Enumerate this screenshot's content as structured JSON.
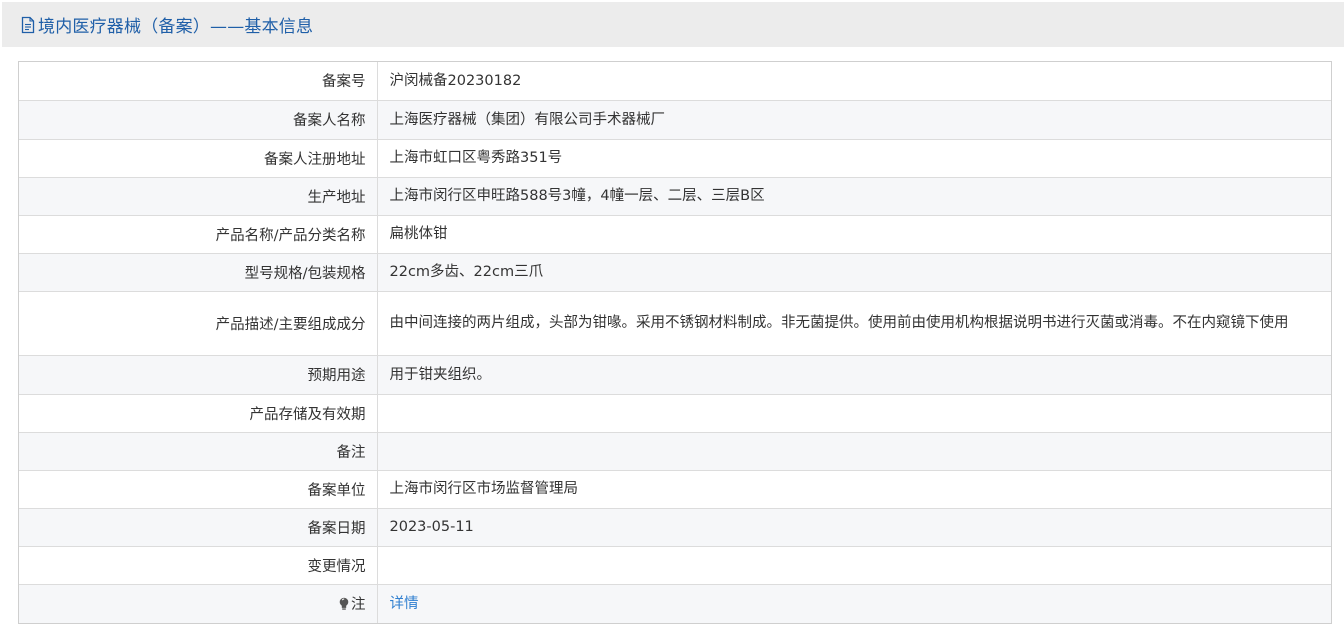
{
  "header": {
    "title": "境内医疗器械（备案）——基本信息"
  },
  "rows": [
    {
      "label": "备案号",
      "value": "沪闵械备20230182"
    },
    {
      "label": "备案人名称",
      "value": "上海医疗器械（集团）有限公司手术器械厂"
    },
    {
      "label": "备案人注册地址",
      "value": "上海市虹口区粤秀路351号"
    },
    {
      "label": "生产地址",
      "value": "上海市闵行区申旺路588号3幢，4幢一层、二层、三层B区"
    },
    {
      "label": "产品名称/产品分类名称",
      "value": "扁桃体钳"
    },
    {
      "label": "型号规格/包装规格",
      "value": "22cm多齿、22cm三爪"
    },
    {
      "label": "产品描述/主要组成成分",
      "value": "由中间连接的两片组成，头部为钳喙。采用不锈钢材料制成。非无菌提供。使用前由使用机构根据说明书进行灭菌或消毒。不在内窥镜下使用"
    },
    {
      "label": "预期用途",
      "value": "用于钳夹组织。"
    },
    {
      "label": "产品存储及有效期",
      "value": ""
    },
    {
      "label": "备注",
      "value": ""
    },
    {
      "label": "备案单位",
      "value": "上海市闵行区市场监督管理局"
    },
    {
      "label": "备案日期",
      "value": "2023-05-11"
    },
    {
      "label": "变更情况",
      "value": ""
    },
    {
      "label": "注",
      "value": "详情"
    }
  ],
  "colors": {
    "title": "#1f5fa8",
    "link": "#2f7fd0",
    "header_bg": "#ececec",
    "stripe_bg": "#f6f7f9"
  },
  "icons": {
    "header": "document-icon",
    "note": "lightbulb-icon"
  }
}
